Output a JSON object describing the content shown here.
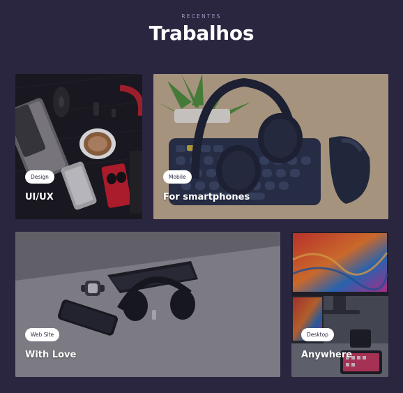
{
  "section": {
    "kicker": "RECENTES",
    "title": "Trabalhos"
  },
  "cards": [
    {
      "badge": "Design",
      "title": "UI/UX",
      "image_icon": "desk-flatlay-image"
    },
    {
      "badge": "Mobile",
      "title": "For smartphones",
      "image_icon": "headphones-keyboard-image"
    },
    {
      "badge": "Web Site",
      "title": "With Love",
      "image_icon": "headphones-phone-desk-image"
    },
    {
      "badge": "Desktop",
      "title": "Anywhere",
      "image_icon": "laptop-monitor-image"
    }
  ],
  "colors": {
    "background": "#2b2640",
    "kicker": "#9d97c2",
    "badge_bg": "#ffffff",
    "badge_text": "#2b2640"
  }
}
